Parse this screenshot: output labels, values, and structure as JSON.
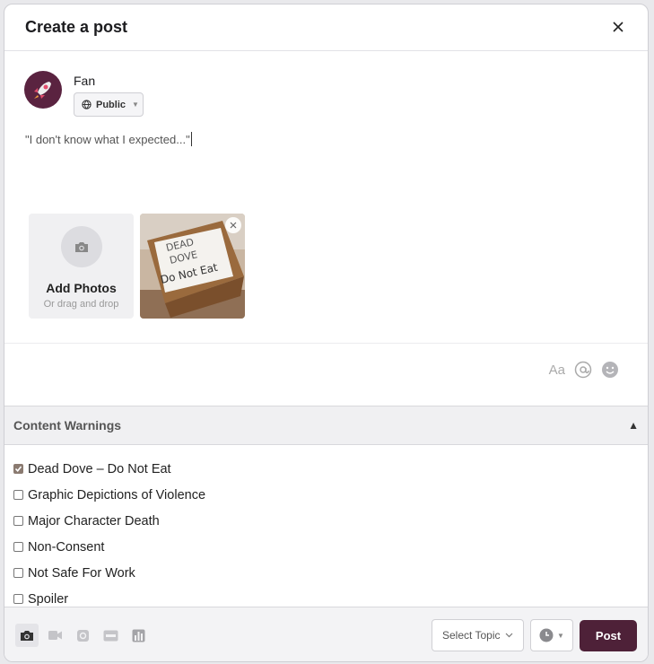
{
  "dialog": {
    "title": "Create a post"
  },
  "author": {
    "name": "Fan",
    "audience": "Public"
  },
  "composer": {
    "text": "\"I don't know what I expected...\""
  },
  "photos": {
    "add_title": "Add Photos",
    "add_subtitle": "Or drag and drop",
    "attached": [
      {
        "note_text": [
          "DEAD",
          "DOVE",
          "Do Not Eat"
        ]
      }
    ]
  },
  "text_tools": {
    "format_label": "Aa"
  },
  "content_warnings": {
    "title": "Content Warnings",
    "toggle": "▲",
    "items": [
      {
        "label": "Dead Dove – Do Not Eat",
        "checked": true
      },
      {
        "label": "Graphic Depictions of Violence",
        "checked": false
      },
      {
        "label": "Major Character Death",
        "checked": false
      },
      {
        "label": "Non-Consent",
        "checked": false
      },
      {
        "label": "Not Safe For Work",
        "checked": false
      },
      {
        "label": "Spoiler",
        "checked": false
      }
    ]
  },
  "footer": {
    "media_buttons": [
      "camera-icon",
      "video-icon",
      "link-icon",
      "gif-icon",
      "poll-icon"
    ],
    "topic_placeholder": "Select Topic",
    "post_label": "Post"
  },
  "colors": {
    "accent": "#4e2138",
    "avatar_bg": "#5a2340",
    "checkbox_checked": "#8a7a70"
  }
}
